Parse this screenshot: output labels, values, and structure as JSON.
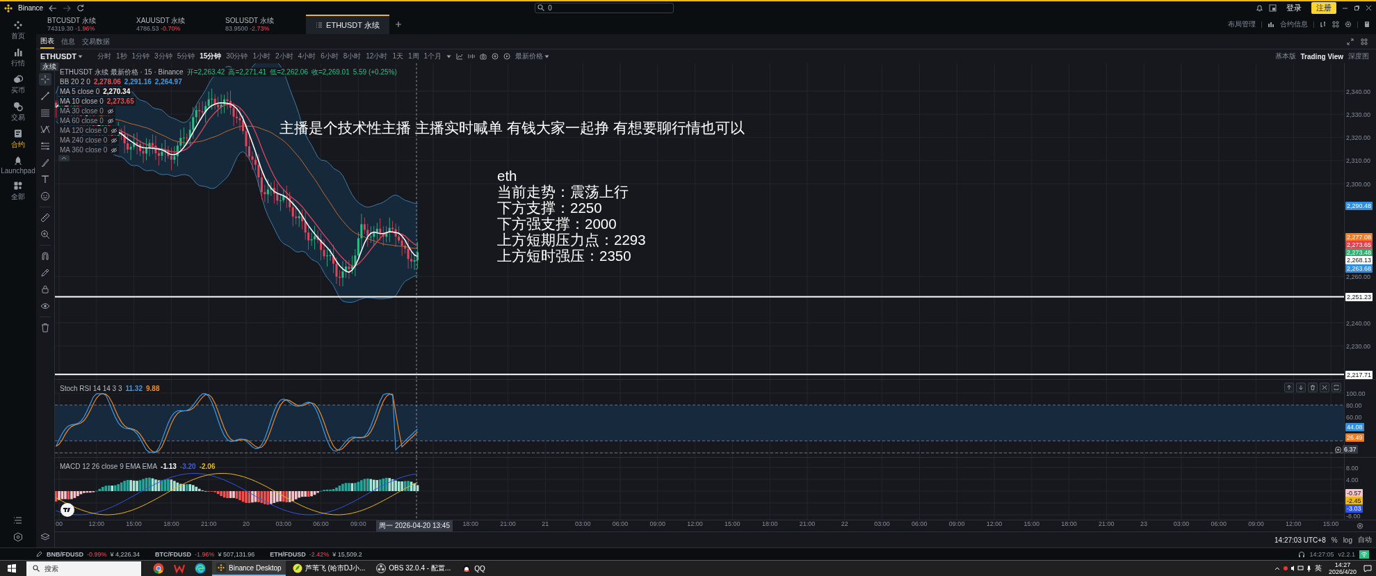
{
  "title_bar": {
    "app": "Binance",
    "search": {
      "value": "0"
    },
    "login": "登录",
    "register": "注册"
  },
  "sidebar": [
    {
      "label": "首页",
      "selected": false
    },
    {
      "label": "行情",
      "selected": false
    },
    {
      "label": "买币",
      "selected": false
    },
    {
      "label": "交易",
      "selected": false
    },
    {
      "label": "合约",
      "selected": true
    },
    {
      "label": "Launchpad",
      "selected": false
    },
    {
      "label": "全部",
      "selected": false
    }
  ],
  "symbol_tabs": [
    {
      "symbol": "BTCUSDT 永续",
      "price": "74319.30",
      "change": "-1.96%",
      "selected": false
    },
    {
      "symbol": "XAUUSDT 永续",
      "price": "4786.53",
      "change": "-0.70%",
      "selected": false
    },
    {
      "symbol": "SOLUSDT 永续",
      "price": "83.9500",
      "change": "-2.73%",
      "selected": false
    },
    {
      "symbol": "ETHUSDT 永续",
      "selected": true
    }
  ],
  "header_links": [
    "布局管理",
    "合约信息"
  ],
  "view_tabs": [
    {
      "label": "图表",
      "selected": true
    },
    {
      "label": "信息",
      "selected": false
    },
    {
      "label": "交易数据",
      "selected": false
    }
  ],
  "toolbar": {
    "symbol": "ETHUSDT",
    "badge": "永续",
    "price_type": "最新价格",
    "intervals": [
      {
        "label": "分时",
        "selected": false
      },
      {
        "label": "1秒",
        "selected": false
      },
      {
        "label": "1分钟",
        "selected": false
      },
      {
        "label": "3分钟",
        "selected": false
      },
      {
        "label": "5分钟",
        "selected": false
      },
      {
        "label": "15分钟",
        "selected": true
      },
      {
        "label": "30分钟",
        "selected": false
      },
      {
        "label": "1小时",
        "selected": false
      },
      {
        "label": "2小时",
        "selected": false
      },
      {
        "label": "4小时",
        "selected": false
      },
      {
        "label": "6小时",
        "selected": false
      },
      {
        "label": "8小时",
        "selected": false
      },
      {
        "label": "12小时",
        "selected": false
      },
      {
        "label": "1天",
        "selected": false
      },
      {
        "label": "1周",
        "selected": false
      },
      {
        "label": "1个月",
        "selected": false
      }
    ]
  },
  "chart_modes": [
    {
      "label": "基本版",
      "selected": false
    },
    {
      "label": "Trading View",
      "selected": true
    },
    {
      "label": "深度图",
      "selected": false
    }
  ],
  "legend": {
    "title": "ETHUSDT 永续 最新价格 · 15 · Binance",
    "ohlc": [
      "开=2,263.42",
      "高=2,271.41",
      "低=2,262.06",
      "收=2,269.01"
    ],
    "change": "5.59 (+0.25%)"
  },
  "indicators": [
    {
      "name": "BB 20 2 0",
      "visible": true,
      "values": [
        {
          "text": "2,278.06",
          "color": "#e0505c"
        },
        {
          "text": "2,291.16",
          "color": "#3d9be0"
        },
        {
          "text": "2,264.97",
          "color": "#3d9be0"
        }
      ]
    },
    {
      "name": "MA 5 close 0",
      "visible": true,
      "values": [
        {
          "text": "2,270.34",
          "color": "#ffffff"
        }
      ]
    },
    {
      "name": "MA 10 close 0",
      "visible": true,
      "values": [
        {
          "text": "2,273.65",
          "color": "#e0505c"
        }
      ]
    },
    {
      "name": "MA 30 close 0",
      "visible": false
    },
    {
      "name": "MA 60 close 0",
      "visible": false
    },
    {
      "name": "MA 120 close 0",
      "visible": false
    },
    {
      "name": "MA 240 close 0",
      "visible": false
    },
    {
      "name": "MA 360 close 0",
      "visible": false
    }
  ],
  "overlay": {
    "banner": "主播是个技术性主播 主播实时喊单 有钱大家一起挣 有想要聊行情也可以",
    "lines": [
      "eth",
      "当前走势：震荡上行",
      "下方支撑：2250",
      "下方强支撑：2000",
      "上方短期压力点：2293",
      "上方短时强压：2350"
    ]
  },
  "price_axis": [
    {
      "kind": "tick",
      "text": "2,340.00"
    },
    {
      "kind": "tick",
      "text": "2,330.00"
    },
    {
      "kind": "tick",
      "text": "2,320.00"
    },
    {
      "kind": "tick",
      "text": "2,310.00"
    },
    {
      "kind": "tick",
      "text": "2,300.00"
    },
    {
      "kind": "tag",
      "text": "2,290.48",
      "color": "#2f8fe6"
    },
    {
      "kind": "tag",
      "text": "2,277.08",
      "color": "#f07c1e"
    },
    {
      "kind": "tag",
      "text": "2,273.65",
      "color": "#e2404e"
    },
    {
      "kind": "tag",
      "text": "2,273.48",
      "color": "#2ead6e"
    },
    {
      "kind": "tag",
      "text": "2,268.13",
      "color": "#ffffff"
    },
    {
      "kind": "tag",
      "text": "2,263.68",
      "color": "#2f8fe6"
    },
    {
      "kind": "tick",
      "text": "2,260.00"
    },
    {
      "kind": "line_tag",
      "text": "2,251.23",
      "color": "#ffffff"
    },
    {
      "kind": "tick",
      "text": "2,240.00"
    },
    {
      "kind": "tick",
      "text": "2,230.00"
    },
    {
      "kind": "line_tag",
      "text": "2,217.71",
      "color": "#ffffff"
    }
  ],
  "stoch_rsi": {
    "name": "Stoch RSI 14 14 3 3",
    "values": [
      {
        "text": "11.32",
        "color": "#3d9be9"
      },
      {
        "text": "9.88",
        "color": "#f08a24"
      }
    ],
    "axis": [
      {
        "kind": "tick",
        "text": "100.00"
      },
      {
        "kind": "tick",
        "text": "80.00"
      },
      {
        "kind": "tick",
        "text": "60.00"
      },
      {
        "kind": "tag",
        "text": "44.08",
        "color": "#2f8fe6"
      },
      {
        "kind": "tag",
        "text": "26.49",
        "color": "#f07c1e"
      },
      {
        "kind": "cursor",
        "text": "6.37",
        "color": "#363a45"
      }
    ]
  },
  "macd": {
    "name": "MACD 12 26 close 9 EMA EMA",
    "values": [
      {
        "text": "-1.13",
        "color": "#ffffff"
      },
      {
        "text": "-3.20",
        "color": "#3d5fe0"
      },
      {
        "text": "-2.06",
        "color": "#f0b90b"
      }
    ],
    "axis": [
      {
        "kind": "tick",
        "text": "8.00"
      },
      {
        "kind": "tick",
        "text": "4.00"
      },
      {
        "kind": "tag",
        "text": "-0.57",
        "color": "#f7c6cc"
      },
      {
        "kind": "tag",
        "text": "-2.45",
        "color": "#f0b90b"
      },
      {
        "kind": "tag",
        "text": "-3.03",
        "color": "#2f55e6"
      },
      {
        "kind": "tick",
        "text": "-8.00"
      }
    ]
  },
  "time_axis": [
    {
      "kind": "tick",
      "text": "00"
    },
    {
      "kind": "tick",
      "text": "12:00"
    },
    {
      "kind": "tick",
      "text": "15:00"
    },
    {
      "kind": "tick",
      "text": "18:00"
    },
    {
      "kind": "tick",
      "text": "21:00"
    },
    {
      "kind": "tick",
      "text": "20"
    },
    {
      "kind": "tick",
      "text": "03:00"
    },
    {
      "kind": "tick",
      "text": "06:00"
    },
    {
      "kind": "tick",
      "text": "09:00"
    },
    {
      "kind": "cursor",
      "text": "周一 2026-04-20  13:45"
    },
    {
      "kind": "tick",
      "text": "18:00"
    },
    {
      "kind": "tick",
      "text": "21:00"
    },
    {
      "kind": "tick",
      "text": "21"
    },
    {
      "kind": "tick",
      "text": "03:00"
    },
    {
      "kind": "tick",
      "text": "06:00"
    },
    {
      "kind": "tick",
      "text": "09:00"
    },
    {
      "kind": "tick",
      "text": "12:00"
    },
    {
      "kind": "tick",
      "text": "15:00"
    },
    {
      "kind": "tick",
      "text": "18:00"
    },
    {
      "kind": "tick",
      "text": "21:00"
    },
    {
      "kind": "tick",
      "text": "22"
    },
    {
      "kind": "tick",
      "text": "03:00"
    },
    {
      "kind": "tick",
      "text": "06:00"
    },
    {
      "kind": "tick",
      "text": "09:00"
    },
    {
      "kind": "tick",
      "text": "12:00"
    },
    {
      "kind": "tick",
      "text": "15:00"
    },
    {
      "kind": "tick",
      "text": "18:00"
    },
    {
      "kind": "tick",
      "text": "21:00"
    },
    {
      "kind": "tick",
      "text": "23"
    },
    {
      "kind": "tick",
      "text": "03:00"
    },
    {
      "kind": "tick",
      "text": "06:00"
    },
    {
      "kind": "tick",
      "text": "09:00"
    },
    {
      "kind": "tick",
      "text": "12:00"
    },
    {
      "kind": "tick",
      "text": "15:00"
    }
  ],
  "chart_footer": {
    "clock": "14:27:03 UTC+8",
    "options": [
      "%",
      "log",
      "自动"
    ]
  },
  "status_bar": {
    "tickers": [
      {
        "pair": "BNB/FDUSD",
        "change": "-0.99%",
        "price": "¥ 4,226.34"
      },
      {
        "pair": "BTC/FDUSD",
        "change": "-1.96%",
        "price": "¥ 507,131.96"
      },
      {
        "pair": "ETH/FDUSD",
        "change": "-2.42%",
        "price": "¥ 15,509.2"
      }
    ],
    "time": "14:27:05",
    "version": "v2.2.1"
  },
  "taskbar": {
    "search": {
      "placeholder": "搜索"
    },
    "apps": [
      {
        "label": "Binance Desktop",
        "selected": true
      },
      {
        "label": "芦苇飞 (哈市DJ小...",
        "selected": false
      },
      {
        "label": "OBS 32.0.4 - 配置...",
        "selected": false
      },
      {
        "label": "QQ",
        "selected": false
      }
    ],
    "ime": "英",
    "time": "14:27",
    "date": "2026/4/20"
  }
}
